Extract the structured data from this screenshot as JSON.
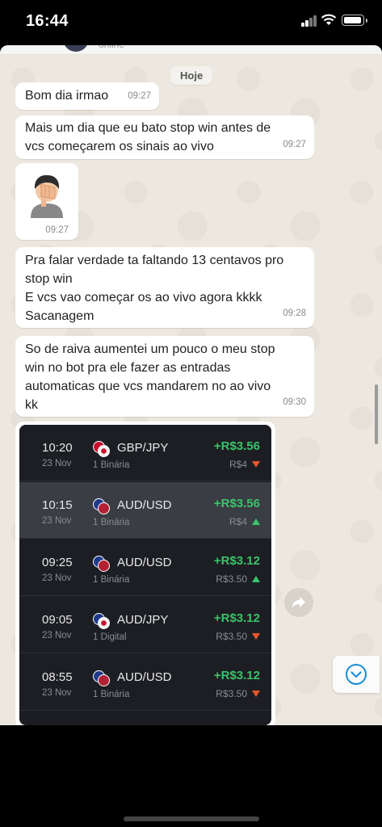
{
  "status_bar": {
    "time": "16:44"
  },
  "chat_header": {
    "status": "online"
  },
  "date_chip": "Hoje",
  "messages": [
    {
      "text": "Bom dia irmao",
      "time": "09:27"
    },
    {
      "text": "Mais um dia que eu bato stop win antes de vcs começarem os sinais ao vivo",
      "time": "09:27"
    },
    {
      "sticker": "facepalm-boy",
      "time": "09:27"
    },
    {
      "lines": [
        "Pra falar verdade ta faltando 13 centavos pro stop win",
        "E vcs vao começar os ao vivo agora kkkk",
        "Sacanagem"
      ],
      "time": "09:28"
    },
    {
      "text": "So de raiva aumentei um pouco o meu stop win no bot pra ele fazer as entradas automaticas que vcs mandarem no ao vivo kk",
      "time": "09:30"
    }
  ],
  "trades": [
    {
      "time": "10:20",
      "date": "23 Nov",
      "pair": "GBP/JPY",
      "type": "1 Binária",
      "profit": "+R$3.56",
      "amount": "R$4",
      "direction": "down",
      "selected": false
    },
    {
      "time": "10:15",
      "date": "23 Nov",
      "pair": "AUD/USD",
      "type": "1 Binária",
      "profit": "+R$3.56",
      "amount": "R$4",
      "direction": "up",
      "selected": true
    },
    {
      "time": "09:25",
      "date": "23 Nov",
      "pair": "AUD/USD",
      "type": "1 Binária",
      "profit": "+R$3.12",
      "amount": "R$3.50",
      "direction": "up",
      "selected": false
    },
    {
      "time": "09:05",
      "date": "23 Nov",
      "pair": "AUD/JPY",
      "type": "1 Digital",
      "profit": "+R$3.12",
      "amount": "R$3.50",
      "direction": "down",
      "selected": false
    },
    {
      "time": "08:55",
      "date": "23 Nov",
      "pair": "AUD/USD",
      "type": "1 Binária",
      "profit": "+R$3.12",
      "amount": "R$3.50",
      "direction": "down",
      "selected": false
    }
  ],
  "colors": {
    "profit": "#39c46a",
    "down": "#e8562f",
    "up": "#39c46a",
    "accent": "#1d8fd6"
  },
  "icons": {
    "forward": "forward-icon",
    "scroll_down": "chevron-down-icon"
  }
}
